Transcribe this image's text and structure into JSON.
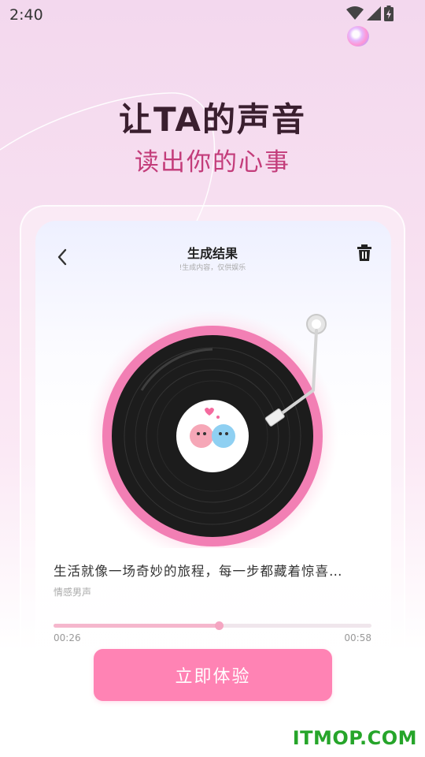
{
  "status_bar": {
    "time": "2:40"
  },
  "promo": {
    "headline": "让TA的声音",
    "subheadline": "读出你的心事"
  },
  "result_page": {
    "title": "生成结果",
    "subtitle": "!生成内容，仅供娱乐",
    "track_text": "生活就像一场奇妙的旅程，每一步都藏着惊喜…",
    "voice_type": "情感男声",
    "current_time": "00:26",
    "total_time": "00:58",
    "progress": 0.52
  },
  "cta": {
    "label": "立即体验"
  },
  "watermark": "ITMOP.COM",
  "colors": {
    "accent": "#ff83b4",
    "headline": "#3a1f2f",
    "subheadline": "#c33c7a",
    "record_ring": "#f27fb4",
    "watermark": "#26a52a"
  }
}
